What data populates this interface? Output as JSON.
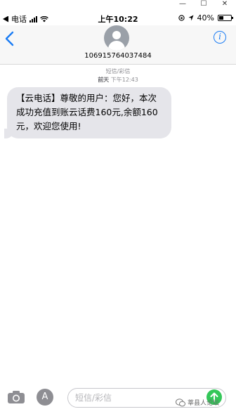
{
  "status_bar": {
    "back_app": "电话",
    "time": "上午10:22",
    "battery_percent": "40%",
    "battery_level": 0.4
  },
  "header": {
    "contact_number": "106915764037484",
    "back_icon": "chevron-left-icon",
    "info_icon": "info-icon"
  },
  "thread": {
    "service_label": "短信/彩信",
    "timestamp_day": "前天",
    "timestamp_time": "下午12:43",
    "messages": [
      {
        "text": "【云电话】尊敬的用户：您好，本次成功充值到账云话费160元,余额160元，欢迎您使用!"
      }
    ]
  },
  "input_bar": {
    "placeholder": "短信/彩信",
    "camera_icon": "camera-icon",
    "apps_icon": "app-store-icon",
    "send_icon": "send-arrow-icon"
  },
  "watermark": {
    "text": "莘县人论坛"
  },
  "colors": {
    "accent": "#1a7cf4",
    "bubble": "#e5e5ea",
    "send": "#34c759"
  }
}
